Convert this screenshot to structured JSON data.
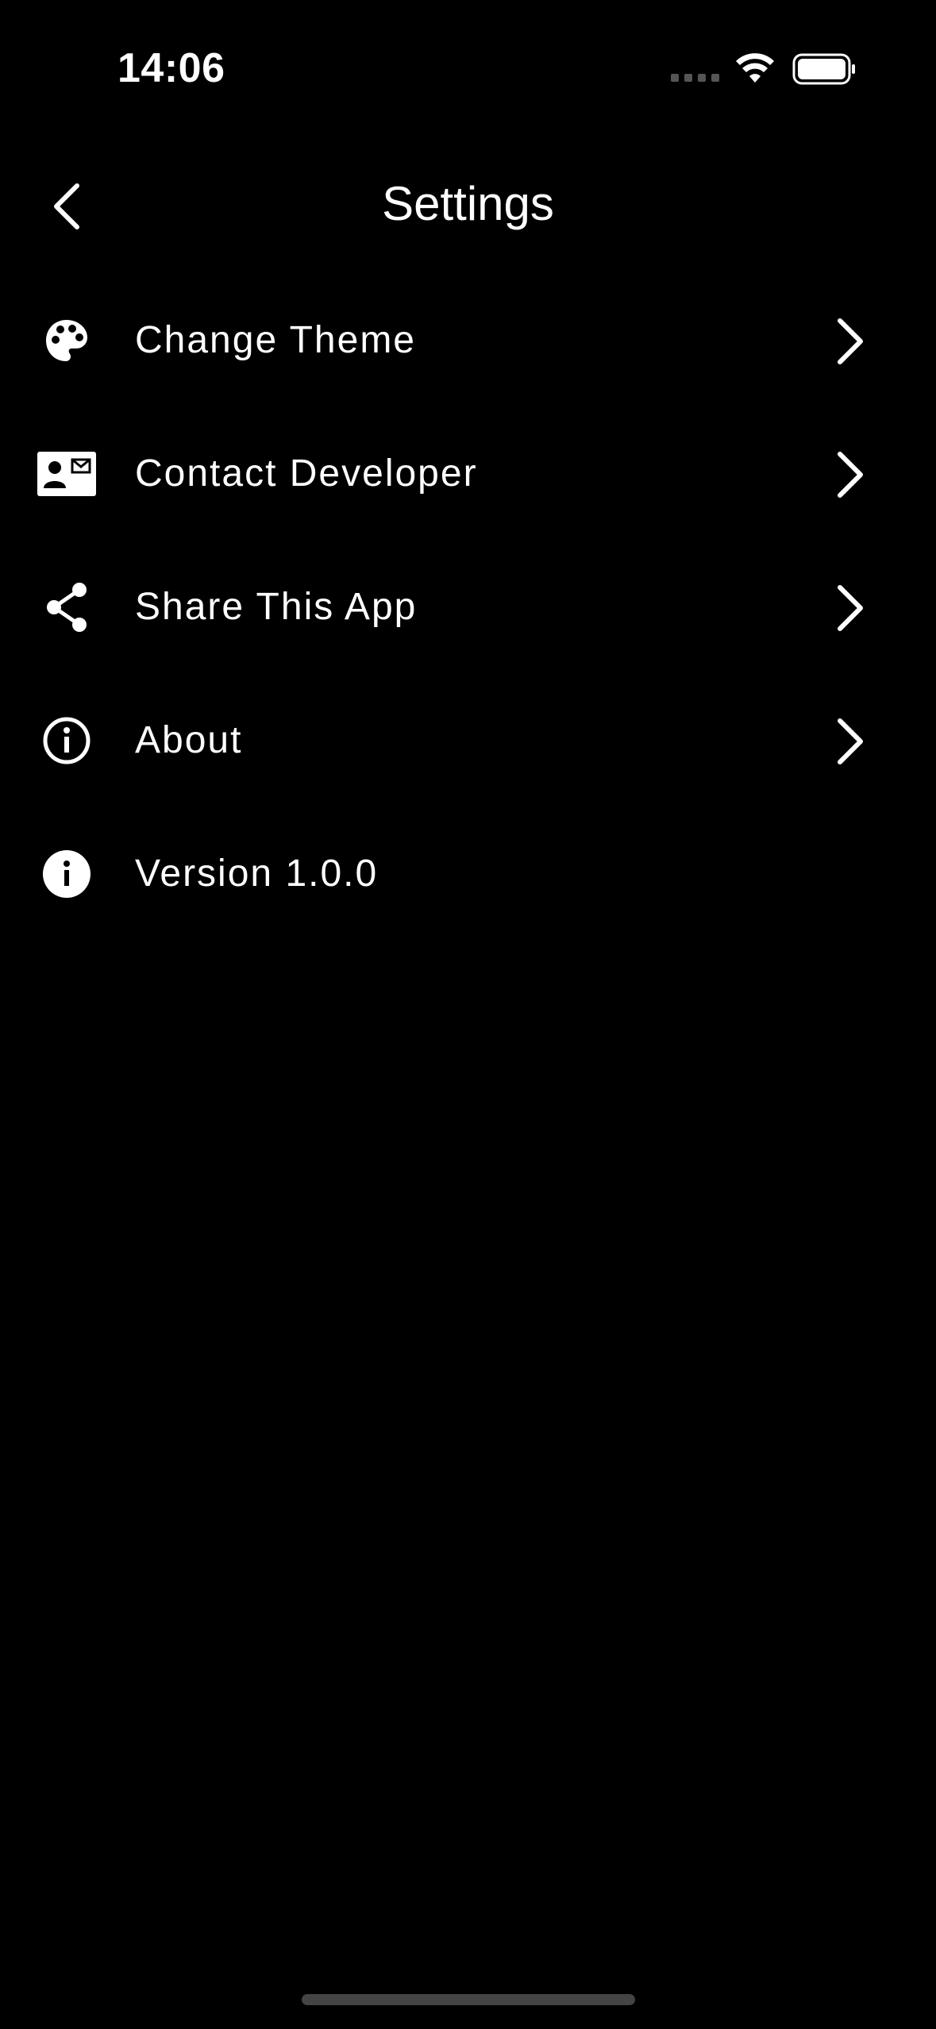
{
  "status_bar": {
    "time": "14:06"
  },
  "header": {
    "title": "Settings",
    "back_icon": "chevron-left-icon"
  },
  "settings": {
    "items": [
      {
        "label": "Change Theme",
        "icon": "palette-icon",
        "has_chevron": true
      },
      {
        "label": "Contact Developer",
        "icon": "contact-card-icon",
        "has_chevron": true
      },
      {
        "label": "Share This App",
        "icon": "share-icon",
        "has_chevron": true
      },
      {
        "label": "About",
        "icon": "info-outline-icon",
        "has_chevron": true
      },
      {
        "label": "Version 1.0.0",
        "icon": "info-filled-icon",
        "has_chevron": false
      }
    ]
  },
  "colors": {
    "background": "#000000",
    "text": "#ffffff",
    "home_indicator": "#444444"
  }
}
